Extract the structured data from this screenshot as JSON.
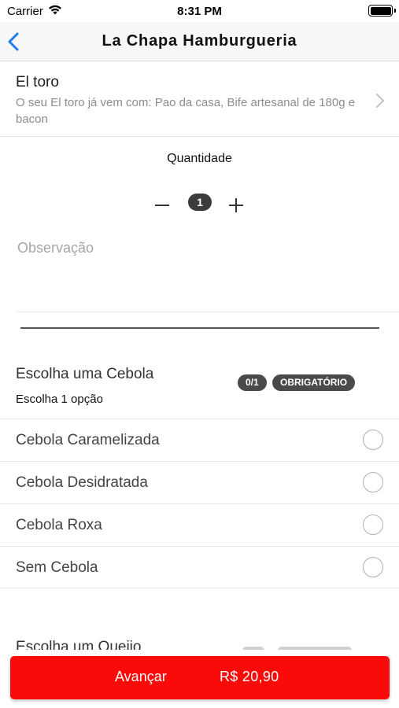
{
  "status_bar": {
    "carrier": "Carrier",
    "time": "8:31 PM"
  },
  "nav": {
    "title": "La Chapa Hamburgueria",
    "back_icon": "chevron-left-icon"
  },
  "product": {
    "name": "El toro",
    "description": "O seu El toro já vem com: Pao da casa, Bife artesanal de 180g e bacon"
  },
  "quantity": {
    "label": "Quantidade",
    "value": "1"
  },
  "observation": {
    "placeholder": "Observação",
    "value": ""
  },
  "group": {
    "title": "Escolha uma Cebola",
    "subtitle": "Escolha 1 opção",
    "count_badge": "0/1",
    "required_badge": "OBRIGATÓRIO",
    "options": [
      {
        "label": "Cebola Caramelizada",
        "selected": false
      },
      {
        "label": "Cebola Desidratada",
        "selected": false
      },
      {
        "label": "Cebola Roxa",
        "selected": false
      },
      {
        "label": "Sem Cebola",
        "selected": false
      }
    ]
  },
  "next_group": {
    "title": "Escolha um Queijo"
  },
  "footer": {
    "advance_label": "Avançar",
    "price": "R$ 20,90"
  },
  "colors": {
    "accent": "#fb0a0a",
    "ios_blue": "#1a7cf5",
    "badge": "#4a4a4a"
  }
}
